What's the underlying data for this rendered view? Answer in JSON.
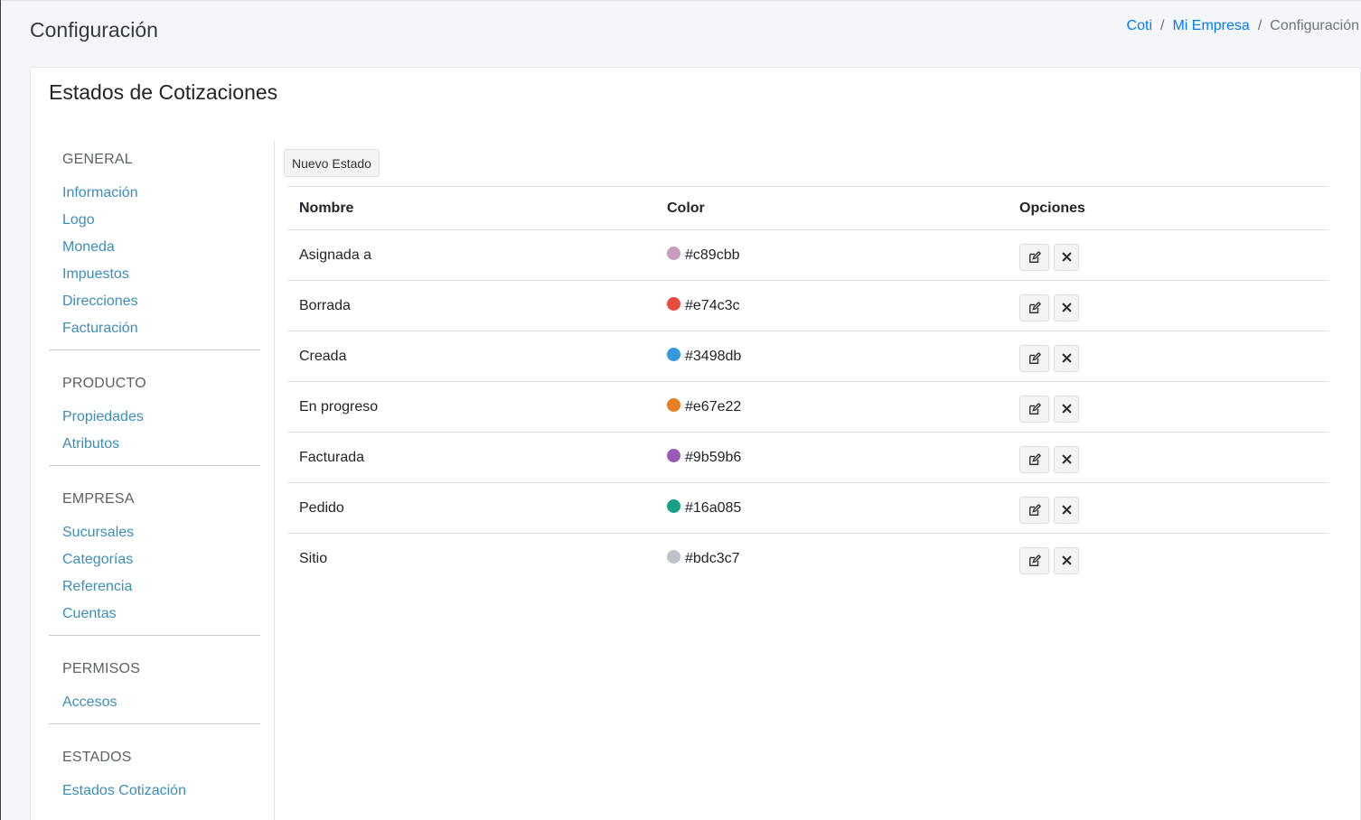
{
  "header": {
    "page_title": "Configuración",
    "breadcrumb": [
      {
        "label": "Coti",
        "link": true
      },
      {
        "label": "Mi Empresa",
        "link": true
      },
      {
        "label": "Configuración",
        "link": false
      }
    ]
  },
  "card": {
    "title": "Estados de Cotizaciones"
  },
  "sidebar": {
    "sections": [
      {
        "heading": "GENERAL",
        "items": [
          "Información",
          "Logo",
          "Moneda",
          "Impuestos",
          "Direcciones",
          "Facturación"
        ]
      },
      {
        "heading": "PRODUCTO",
        "items": [
          "Propiedades",
          "Atributos"
        ]
      },
      {
        "heading": "EMPRESA",
        "items": [
          "Sucursales",
          "Categorías",
          "Referencia",
          "Cuentas"
        ]
      },
      {
        "heading": "PERMISOS",
        "items": [
          "Accesos"
        ]
      },
      {
        "heading": "ESTADOS",
        "items": [
          "Estados Cotización"
        ]
      }
    ]
  },
  "toolbar": {
    "new_label": "Nuevo Estado"
  },
  "table": {
    "headers": [
      "Nombre",
      "Color",
      "Opciones"
    ],
    "rows": [
      {
        "name": "Asignada a",
        "color": "#c89cbb"
      },
      {
        "name": "Borrada",
        "color": "#e74c3c"
      },
      {
        "name": "Creada",
        "color": "#3498db"
      },
      {
        "name": "En progreso",
        "color": "#e67e22"
      },
      {
        "name": "Facturada",
        "color": "#9b59b6"
      },
      {
        "name": "Pedido",
        "color": "#16a085"
      },
      {
        "name": "Sitio",
        "color": "#bdc3c7"
      }
    ],
    "row_actions": [
      "edit-icon",
      "close-icon"
    ]
  },
  "colors": {
    "link": "#3c8dbc",
    "breadcrumb_link": "#007bff"
  }
}
